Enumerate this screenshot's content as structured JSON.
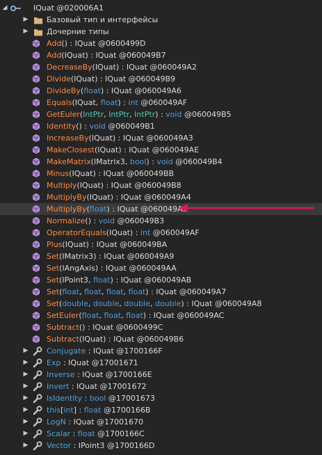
{
  "root": {
    "label": "IQuat @020006A1",
    "expander": "◢"
  },
  "folders": [
    {
      "label": "Базовый тип и интерфейсы"
    },
    {
      "label": "Дочерние типы"
    }
  ],
  "methods": [
    {
      "name": "Add",
      "params": [],
      "ret": "IQuat",
      "ret_kind": "ty",
      "token": "@0600499D"
    },
    {
      "name": "Add",
      "params": [
        [
          "IQuat",
          "ty"
        ]
      ],
      "ret": "IQuat",
      "ret_kind": "ty",
      "token": "@060049B7"
    },
    {
      "name": "DecreaseBy",
      "params": [
        [
          "IQuat",
          "ty"
        ]
      ],
      "ret": "IQuat",
      "ret_kind": "ty",
      "token": "@060049A2"
    },
    {
      "name": "Divide",
      "params": [
        [
          "IQuat",
          "ty"
        ]
      ],
      "ret": "IQuat",
      "ret_kind": "ty",
      "token": "@060049B9"
    },
    {
      "name": "DivideBy",
      "params": [
        [
          "float",
          "kw"
        ]
      ],
      "ret": "IQuat",
      "ret_kind": "ty",
      "token": "@060049A6"
    },
    {
      "name": "Equals",
      "params": [
        [
          "IQuat",
          "ty"
        ],
        [
          "float",
          "kw"
        ]
      ],
      "ret": "int",
      "ret_kind": "kw",
      "token": "@060049AF"
    },
    {
      "name": "GetEuler",
      "params": [
        [
          "IntPtr",
          "pt"
        ],
        [
          "IntPtr",
          "pt"
        ],
        [
          "IntPtr",
          "pt"
        ]
      ],
      "ret": "void",
      "ret_kind": "kw",
      "token": "@060049B5"
    },
    {
      "name": "Identity",
      "params": [],
      "ret": "void",
      "ret_kind": "kw",
      "token": "@060049B1"
    },
    {
      "name": "IncreaseBy",
      "params": [
        [
          "IQuat",
          "ty"
        ]
      ],
      "ret": "IQuat",
      "ret_kind": "ty",
      "token": "@060049A3"
    },
    {
      "name": "MakeClosest",
      "params": [
        [
          "IQuat",
          "ty"
        ]
      ],
      "ret": "IQuat",
      "ret_kind": "ty",
      "token": "@060049AE"
    },
    {
      "name": "MakeMatrix",
      "params": [
        [
          "IMatrix3",
          "ty"
        ],
        [
          "bool",
          "kw"
        ]
      ],
      "ret": "void",
      "ret_kind": "kw",
      "token": "@060049B4"
    },
    {
      "name": "Minus",
      "params": [
        [
          "IQuat",
          "ty"
        ]
      ],
      "ret": "IQuat",
      "ret_kind": "ty",
      "token": "@060049BB"
    },
    {
      "name": "Multiply",
      "params": [
        [
          "IQuat",
          "ty"
        ]
      ],
      "ret": "IQuat",
      "ret_kind": "ty",
      "token": "@060049B8"
    },
    {
      "name": "MultiplyBy",
      "params": [
        [
          "IQuat",
          "ty"
        ]
      ],
      "ret": "IQuat",
      "ret_kind": "ty",
      "token": "@060049A4"
    },
    {
      "name": "MultiplyBy",
      "params": [
        [
          "float",
          "kw"
        ]
      ],
      "ret": "IQuat",
      "ret_kind": "ty",
      "token": "@060049A5",
      "selected": true
    },
    {
      "name": "Normalize",
      "params": [],
      "ret": "void",
      "ret_kind": "kw",
      "token": "@060049B3"
    },
    {
      "name": "OperatorEquals",
      "params": [
        [
          "IQuat",
          "ty"
        ]
      ],
      "ret": "int",
      "ret_kind": "kw",
      "token": "@060049AF"
    },
    {
      "name": "Plus",
      "params": [
        [
          "IQuat",
          "ty"
        ]
      ],
      "ret": "IQuat",
      "ret_kind": "ty",
      "token": "@060049BA"
    },
    {
      "name": "Set",
      "params": [
        [
          "IMatrix3",
          "ty"
        ]
      ],
      "ret": "IQuat",
      "ret_kind": "ty",
      "token": "@060049A9"
    },
    {
      "name": "Set",
      "params": [
        [
          "IAngAxis",
          "ty"
        ]
      ],
      "ret": "IQuat",
      "ret_kind": "ty",
      "token": "@060049AA"
    },
    {
      "name": "Set",
      "params": [
        [
          "IPoint3",
          "ty"
        ],
        [
          "float",
          "kw"
        ]
      ],
      "ret": "IQuat",
      "ret_kind": "ty",
      "token": "@060049AB"
    },
    {
      "name": "Set",
      "params": [
        [
          "float",
          "kw"
        ],
        [
          "float",
          "kw"
        ],
        [
          "float",
          "kw"
        ],
        [
          "float",
          "kw"
        ]
      ],
      "ret": "IQuat",
      "ret_kind": "ty",
      "token": "@060049A7"
    },
    {
      "name": "Set",
      "params": [
        [
          "double",
          "kw"
        ],
        [
          "double",
          "kw"
        ],
        [
          "double",
          "kw"
        ],
        [
          "double",
          "kw"
        ]
      ],
      "ret": "IQuat",
      "ret_kind": "ty",
      "token": "@060049A8"
    },
    {
      "name": "SetEuler",
      "params": [
        [
          "float",
          "kw"
        ],
        [
          "float",
          "kw"
        ],
        [
          "float",
          "kw"
        ]
      ],
      "ret": "IQuat",
      "ret_kind": "ty",
      "token": "@060049AC"
    },
    {
      "name": "Subtract",
      "params": [],
      "ret": "IQuat",
      "ret_kind": "ty",
      "token": "@0600499C"
    },
    {
      "name": "Subtract",
      "params": [
        [
          "IQuat",
          "ty"
        ]
      ],
      "ret": "IQuat",
      "ret_kind": "ty",
      "token": "@060049B6"
    }
  ],
  "properties": [
    {
      "name": "Conjugate",
      "ret": "IQuat",
      "ret_kind": "ty",
      "token": "@1700166F"
    },
    {
      "name": "Exp",
      "ret": "IQuat",
      "ret_kind": "ty",
      "token": "@17001671"
    },
    {
      "name": "Inverse",
      "ret": "IQuat",
      "ret_kind": "ty",
      "token": "@1700166E"
    },
    {
      "name": "Invert",
      "ret": "IQuat",
      "ret_kind": "ty",
      "token": "@17001672"
    },
    {
      "name": "IsIdentity",
      "ret": "bool",
      "ret_kind": "kw",
      "token": "@17001673"
    },
    {
      "name": "this",
      "index": "int",
      "ret": "float",
      "ret_kind": "kw",
      "token": "@1700166B"
    },
    {
      "name": "LogN",
      "ret": "IQuat",
      "ret_kind": "ty",
      "token": "@17001670"
    },
    {
      "name": "Scalar",
      "ret": "float",
      "ret_kind": "kw",
      "token": "@1700166C"
    },
    {
      "name": "Vector",
      "ret": "IPoint3",
      "ret_kind": "ty",
      "token": "@1700166D"
    }
  ],
  "colors": {
    "background": "#252526",
    "method_name": "#ff8c3f",
    "property_name": "#4fa3d9",
    "keyword": "#569cd6",
    "value_type": "#4ec9b0",
    "selection": "#3a3a3c",
    "arrow": "#e8174d"
  }
}
